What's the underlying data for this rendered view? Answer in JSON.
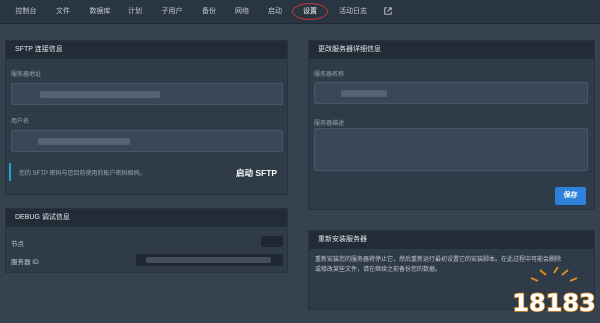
{
  "nav": {
    "tabs": [
      {
        "label": "控制台"
      },
      {
        "label": "文件"
      },
      {
        "label": "数据库"
      },
      {
        "label": "计划"
      },
      {
        "label": "子用户"
      },
      {
        "label": "备份"
      },
      {
        "label": "网络"
      },
      {
        "label": "启动"
      },
      {
        "label": "设置"
      },
      {
        "label": "活动日志"
      }
    ],
    "active_tab": "设置",
    "external_icon": "external-link-icon"
  },
  "sftp": {
    "title": "SFTP 连接信息",
    "server_address_label": "服务器地址",
    "username_label": "用户名",
    "notice": "您的 SFTP 密码与您目前使用的账户密码相同。",
    "launch_button": "启动 SFTP"
  },
  "debug": {
    "title": "DEBUG 调试信息",
    "node_label": "节点",
    "server_id_label": "服务器 ID"
  },
  "details": {
    "title": "更改服务器详细信息",
    "server_name_label": "服务器名称",
    "server_desc_label": "服务器描述",
    "save_button": "保存"
  },
  "reinstall": {
    "title": "重新安装服务器",
    "description": "重新安装您的服务器将停止它，然后重新运行最初设置它的安装脚本。在此过程中可能会删除或修改某些文件，请在继续之前备份您的数据。"
  },
  "watermark": {
    "text": "18183"
  },
  "colors": {
    "background": "#364250",
    "nav_bg": "#2a3542",
    "panel_head": "#222c37",
    "accent_blue": "#2e82d9",
    "notice_bar": "#18a9c9",
    "active_ring": "#c2353a"
  }
}
